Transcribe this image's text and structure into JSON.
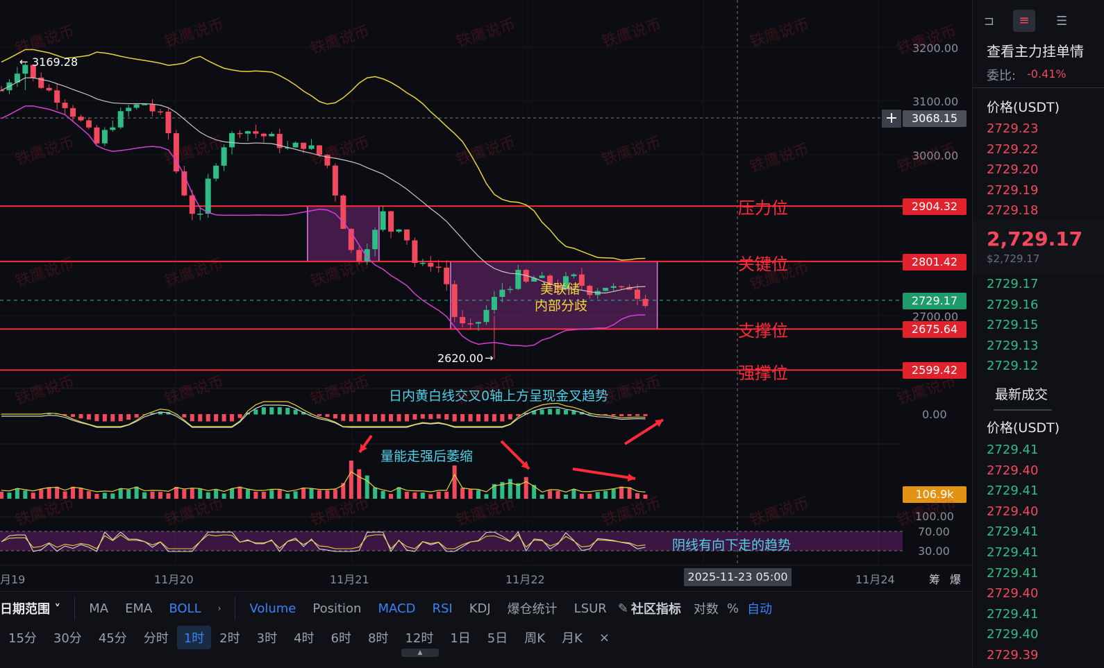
{
  "chart_data": {
    "type": "candlestick",
    "instrument_quote": "USDT",
    "y_ticks": [
      "3200.00",
      "3100.00",
      "3000.00",
      "2700.00"
    ],
    "x_ticks": [
      "月19",
      "11月20",
      "11月21",
      "11月22",
      "11月24"
    ],
    "crosshair": {
      "time_label": "2025-11-23 05:00",
      "price_label": "3068.15"
    },
    "current_price_tag": "2729.17",
    "annotations": {
      "high": "3169.28",
      "low": "2620.00"
    },
    "levels": [
      {
        "name": "压力位",
        "price": "2904.32",
        "value": 2904.32
      },
      {
        "name": "关键位",
        "price": "2801.42",
        "value": 2801.42
      },
      {
        "name": "支撑位",
        "price": "2675.64",
        "value": 2675.64
      },
      {
        "name": "强撑位",
        "price": "2599.42",
        "value": 2599.42
      }
    ],
    "boxes": [
      {
        "t0": 38.5,
        "t1": 47.5,
        "p_hi": 2904.32,
        "p_lo": 2801.42
      },
      {
        "t0": 56.5,
        "t1": 82.5,
        "p_hi": 2801.42,
        "p_lo": 2675.64,
        "label_line1": "美联储",
        "label_line2": "内部分歧"
      }
    ],
    "close_path": [
      [
        0,
        3120
      ],
      [
        2,
        3160
      ],
      [
        3,
        3169
      ],
      [
        4,
        3140
      ],
      [
        5,
        3130
      ],
      [
        8,
        3095
      ],
      [
        10,
        3060
      ],
      [
        12,
        3020
      ],
      [
        14,
        3060
      ],
      [
        16,
        3085
      ],
      [
        18,
        3095
      ],
      [
        20,
        3070
      ],
      [
        21,
        3040
      ],
      [
        22,
        2970
      ],
      [
        23,
        2930
      ],
      [
        24,
        2895
      ],
      [
        25,
        2880
      ],
      [
        26,
        2950
      ],
      [
        27,
        2990
      ],
      [
        28,
        3020
      ],
      [
        30,
        3050
      ],
      [
        32,
        3040
      ],
      [
        34,
        3030
      ],
      [
        36,
        3010
      ],
      [
        38,
        3020
      ],
      [
        40,
        3000
      ],
      [
        41,
        2980
      ],
      [
        42,
        2930
      ],
      [
        43,
        2870
      ],
      [
        44,
        2820
      ],
      [
        45,
        2810
      ],
      [
        46,
        2835
      ],
      [
        47,
        2855
      ],
      [
        48,
        2890
      ],
      [
        49,
        2860
      ],
      [
        50,
        2870
      ],
      [
        51,
        2845
      ],
      [
        52,
        2800
      ],
      [
        53,
        2790
      ],
      [
        54,
        2800
      ],
      [
        55,
        2790
      ],
      [
        56,
        2760
      ],
      [
        57,
        2700
      ],
      [
        58,
        2680
      ],
      [
        59,
        2675
      ],
      [
        60,
        2690
      ],
      [
        61,
        2710
      ],
      [
        62,
        2730
      ],
      [
        63,
        2750
      ],
      [
        64,
        2760
      ],
      [
        65,
        2775
      ],
      [
        66,
        2760
      ],
      [
        67,
        2770
      ],
      [
        68,
        2765
      ],
      [
        69,
        2760
      ],
      [
        70,
        2758
      ],
      [
        71,
        2765
      ],
      [
        72,
        2770
      ],
      [
        73,
        2758
      ],
      [
        74,
        2748
      ],
      [
        75,
        2752
      ],
      [
        76,
        2756
      ],
      [
        77,
        2750
      ],
      [
        78,
        2745
      ],
      [
        79,
        2755
      ],
      [
        80,
        2740
      ],
      [
        81,
        2729
      ]
    ],
    "macd": {
      "label": "0.00",
      "note": "日内黄白线交叉0轴上方呈现金叉趋势"
    },
    "volume": {
      "label": "106.9k",
      "note": "量能走强后萎缩"
    },
    "rsi": {
      "ticks": [
        "100.00",
        "70.00",
        "30.00"
      ],
      "note": "阴线有向下走的趋势"
    }
  },
  "toolbar": {
    "range_label": "日期范围",
    "indicators_main": [
      "MA",
      "EMA",
      "BOLL"
    ],
    "indicators_sub": [
      "Volume",
      "Position",
      "MACD",
      "RSI",
      "KDJ",
      "爆仓统计",
      "LSUR"
    ],
    "community": "社区指标",
    "right_opts": [
      "对数",
      "%",
      "自动"
    ],
    "timeframes": [
      "15分",
      "30分",
      "45分",
      "分时",
      "1时",
      "2时",
      "3时",
      "4时",
      "6时",
      "8时",
      "12时",
      "1日",
      "5日",
      "周K",
      "月K"
    ],
    "active_timeframe": "1时",
    "bottom_right": [
      "筹",
      "爆"
    ]
  },
  "panel": {
    "title": "查看主力挂单情",
    "ratio_label": "委比:",
    "ratio_value": "-0.41%",
    "price_header": "价格(USDT)",
    "asks": [
      "2729.23",
      "2729.22",
      "2729.20",
      "2729.19",
      "2729.18"
    ],
    "last_price": "2,729.17",
    "last_price_usd": "$2,729.17",
    "bids": [
      "2729.17",
      "2729.16",
      "2729.15",
      "2729.13",
      "2729.12"
    ],
    "trades_title": "最新成交",
    "trades_header": "价格(USDT)",
    "trades": [
      {
        "p": "2729.41",
        "c": "green"
      },
      {
        "p": "2729.40",
        "c": "red"
      },
      {
        "p": "2729.41",
        "c": "green"
      },
      {
        "p": "2729.40",
        "c": "red"
      },
      {
        "p": "2729.41",
        "c": "green"
      },
      {
        "p": "2729.41",
        "c": "green"
      },
      {
        "p": "2729.41",
        "c": "green"
      },
      {
        "p": "2729.40",
        "c": "red"
      },
      {
        "p": "2729.41",
        "c": "green"
      },
      {
        "p": "2729.40",
        "c": "green"
      },
      {
        "p": "2729.39",
        "c": "red"
      }
    ]
  },
  "watermark": "铁鹰说币",
  "colors": {
    "up": "#2fbd85",
    "down": "#f2495e",
    "level": "#ff2b3a",
    "boll_upper": "#e8d43a",
    "boll_mid": "#c8c8c8",
    "boll_lower": "#d63fd6"
  }
}
